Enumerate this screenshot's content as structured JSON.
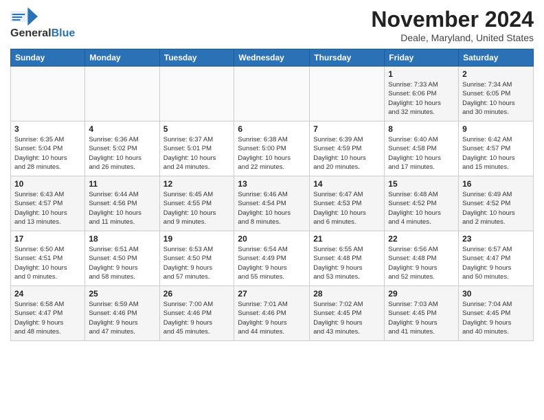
{
  "header": {
    "logo_general": "General",
    "logo_blue": "Blue",
    "month_title": "November 2024",
    "location": "Deale, Maryland, United States"
  },
  "days_of_week": [
    "Sunday",
    "Monday",
    "Tuesday",
    "Wednesday",
    "Thursday",
    "Friday",
    "Saturday"
  ],
  "weeks": [
    [
      {
        "day": "",
        "info": ""
      },
      {
        "day": "",
        "info": ""
      },
      {
        "day": "",
        "info": ""
      },
      {
        "day": "",
        "info": ""
      },
      {
        "day": "",
        "info": ""
      },
      {
        "day": "1",
        "info": "Sunrise: 7:33 AM\nSunset: 6:06 PM\nDaylight: 10 hours\nand 32 minutes."
      },
      {
        "day": "2",
        "info": "Sunrise: 7:34 AM\nSunset: 6:05 PM\nDaylight: 10 hours\nand 30 minutes."
      }
    ],
    [
      {
        "day": "3",
        "info": "Sunrise: 6:35 AM\nSunset: 5:04 PM\nDaylight: 10 hours\nand 28 minutes."
      },
      {
        "day": "4",
        "info": "Sunrise: 6:36 AM\nSunset: 5:02 PM\nDaylight: 10 hours\nand 26 minutes."
      },
      {
        "day": "5",
        "info": "Sunrise: 6:37 AM\nSunset: 5:01 PM\nDaylight: 10 hours\nand 24 minutes."
      },
      {
        "day": "6",
        "info": "Sunrise: 6:38 AM\nSunset: 5:00 PM\nDaylight: 10 hours\nand 22 minutes."
      },
      {
        "day": "7",
        "info": "Sunrise: 6:39 AM\nSunset: 4:59 PM\nDaylight: 10 hours\nand 20 minutes."
      },
      {
        "day": "8",
        "info": "Sunrise: 6:40 AM\nSunset: 4:58 PM\nDaylight: 10 hours\nand 17 minutes."
      },
      {
        "day": "9",
        "info": "Sunrise: 6:42 AM\nSunset: 4:57 PM\nDaylight: 10 hours\nand 15 minutes."
      }
    ],
    [
      {
        "day": "10",
        "info": "Sunrise: 6:43 AM\nSunset: 4:57 PM\nDaylight: 10 hours\nand 13 minutes."
      },
      {
        "day": "11",
        "info": "Sunrise: 6:44 AM\nSunset: 4:56 PM\nDaylight: 10 hours\nand 11 minutes."
      },
      {
        "day": "12",
        "info": "Sunrise: 6:45 AM\nSunset: 4:55 PM\nDaylight: 10 hours\nand 9 minutes."
      },
      {
        "day": "13",
        "info": "Sunrise: 6:46 AM\nSunset: 4:54 PM\nDaylight: 10 hours\nand 8 minutes."
      },
      {
        "day": "14",
        "info": "Sunrise: 6:47 AM\nSunset: 4:53 PM\nDaylight: 10 hours\nand 6 minutes."
      },
      {
        "day": "15",
        "info": "Sunrise: 6:48 AM\nSunset: 4:52 PM\nDaylight: 10 hours\nand 4 minutes."
      },
      {
        "day": "16",
        "info": "Sunrise: 6:49 AM\nSunset: 4:52 PM\nDaylight: 10 hours\nand 2 minutes."
      }
    ],
    [
      {
        "day": "17",
        "info": "Sunrise: 6:50 AM\nSunset: 4:51 PM\nDaylight: 10 hours\nand 0 minutes."
      },
      {
        "day": "18",
        "info": "Sunrise: 6:51 AM\nSunset: 4:50 PM\nDaylight: 9 hours\nand 58 minutes."
      },
      {
        "day": "19",
        "info": "Sunrise: 6:53 AM\nSunset: 4:50 PM\nDaylight: 9 hours\nand 57 minutes."
      },
      {
        "day": "20",
        "info": "Sunrise: 6:54 AM\nSunset: 4:49 PM\nDaylight: 9 hours\nand 55 minutes."
      },
      {
        "day": "21",
        "info": "Sunrise: 6:55 AM\nSunset: 4:48 PM\nDaylight: 9 hours\nand 53 minutes."
      },
      {
        "day": "22",
        "info": "Sunrise: 6:56 AM\nSunset: 4:48 PM\nDaylight: 9 hours\nand 52 minutes."
      },
      {
        "day": "23",
        "info": "Sunrise: 6:57 AM\nSunset: 4:47 PM\nDaylight: 9 hours\nand 50 minutes."
      }
    ],
    [
      {
        "day": "24",
        "info": "Sunrise: 6:58 AM\nSunset: 4:47 PM\nDaylight: 9 hours\nand 48 minutes."
      },
      {
        "day": "25",
        "info": "Sunrise: 6:59 AM\nSunset: 4:46 PM\nDaylight: 9 hours\nand 47 minutes."
      },
      {
        "day": "26",
        "info": "Sunrise: 7:00 AM\nSunset: 4:46 PM\nDaylight: 9 hours\nand 45 minutes."
      },
      {
        "day": "27",
        "info": "Sunrise: 7:01 AM\nSunset: 4:46 PM\nDaylight: 9 hours\nand 44 minutes."
      },
      {
        "day": "28",
        "info": "Sunrise: 7:02 AM\nSunset: 4:45 PM\nDaylight: 9 hours\nand 43 minutes."
      },
      {
        "day": "29",
        "info": "Sunrise: 7:03 AM\nSunset: 4:45 PM\nDaylight: 9 hours\nand 41 minutes."
      },
      {
        "day": "30",
        "info": "Sunrise: 7:04 AM\nSunset: 4:45 PM\nDaylight: 9 hours\nand 40 minutes."
      }
    ]
  ]
}
